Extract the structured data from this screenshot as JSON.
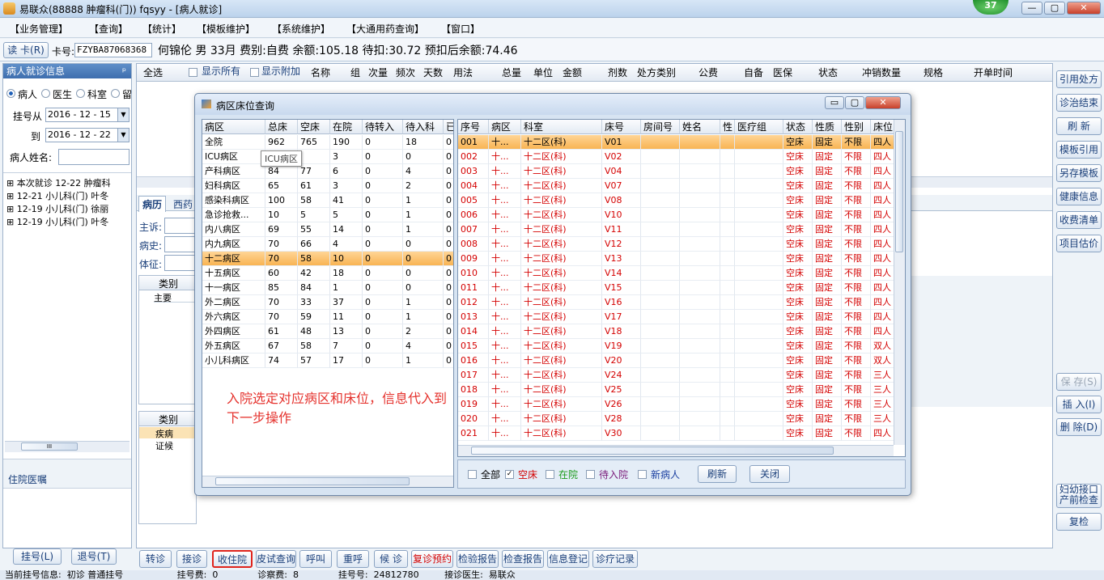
{
  "window": {
    "title": "易联众(88888 肿瘤科(门)) fqsyy - [病人就诊]",
    "badge": "37",
    "min": "—",
    "max": "▢",
    "close": "✕"
  },
  "menu": [
    "【业务管理】",
    "【查询】",
    "【统计】",
    "【模板维护】",
    "【系统维护】",
    "【大通用药查询】",
    "【窗口】"
  ],
  "patient": {
    "read_card": "读 卡(R)",
    "card_label": "卡号:",
    "card_no": "FZYBA87068368",
    "summary": "何锦伦 男 33月 费别:自费 余额:105.18 待扣:30.72 预扣后余额:74.46"
  },
  "left": {
    "header": "病人就诊信息",
    "pin": "ᵖ",
    "radios": [
      "病人",
      "医生",
      "科室",
      "留"
    ],
    "date_from_label": "挂号从",
    "date_from": "2016 - 12 - 15",
    "date_to_label": "到",
    "date_to": "2016 - 12 - 22",
    "name_label": "病人姓名:",
    "tree": [
      "本次就诊 12-22 肿瘤科",
      "12-21 小儿科(门) 叶冬",
      "12-19 小儿科(门) 徐丽",
      "12-19 小儿科(门) 叶冬"
    ],
    "scroll_thumb": "III",
    "advice_label": "住院医嘱",
    "btn_register": "挂号(L)",
    "btn_return": "退号(T)"
  },
  "center": {
    "columns": [
      "全选",
      "显示所有",
      "显示附加",
      "名称",
      "组",
      "次量",
      "频次",
      "天数",
      "用法",
      "总量",
      "单位",
      "金额",
      "剂数",
      "处方类别",
      "公费",
      "自备",
      "医保",
      "状态",
      "冲销数量",
      "规格",
      "开单时间"
    ],
    "tabs": [
      "病历",
      "西药"
    ],
    "fields": [
      "主诉:",
      "病史:",
      "体征:"
    ],
    "grid1": {
      "col": "类别",
      "row": "主要"
    },
    "grid2": {
      "col": "类别",
      "rows": [
        "疾病",
        "证候"
      ]
    }
  },
  "right_buttons": [
    "引用处方",
    "诊治结束",
    "刷 新",
    "模板引用",
    "另存模板",
    "健康信息",
    "收费清单",
    "项目估价"
  ],
  "right_buttons_lower": [
    "保 存(S)",
    "插 入(I)",
    "删 除(D)"
  ],
  "right_buttons_bottom": [
    "妇幼接口\n产前检查",
    "复检"
  ],
  "bottom_buttons": [
    "转诊",
    "接诊",
    "收住院",
    "皮试查询",
    "呼叫",
    "重呼",
    "候 诊",
    "复诊预约",
    "检验报告",
    "检查报告",
    "信息登记",
    "诊疗记录"
  ],
  "status_line": "当前挂号信息:  初诊 普通挂号                   挂号费:  0              诊察费:  8              挂号号:  24812780         接诊医生:  易联众",
  "dialog": {
    "title": "病区床位查询",
    "ward_columns": [
      "病区",
      "总床",
      "空床",
      "在院",
      "待转入",
      "待入科",
      "已"
    ],
    "wards": [
      [
        "全院",
        "962",
        "765",
        "190",
        "0",
        "18",
        "0"
      ],
      [
        "ICU病区",
        "",
        "",
        "3",
        "0",
        "0",
        "0"
      ],
      [
        "产科病区",
        "84",
        "77",
        "6",
        "0",
        "4",
        "0"
      ],
      [
        "妇科病区",
        "65",
        "61",
        "3",
        "0",
        "2",
        "0"
      ],
      [
        "感染科病区",
        "100",
        "58",
        "41",
        "0",
        "1",
        "0"
      ],
      [
        "急诊抢救...",
        "10",
        "5",
        "5",
        "0",
        "1",
        "0"
      ],
      [
        "内八病区",
        "69",
        "55",
        "14",
        "0",
        "1",
        "0"
      ],
      [
        "内九病区",
        "70",
        "66",
        "4",
        "0",
        "0",
        "0"
      ],
      [
        "十二病区",
        "70",
        "58",
        "10",
        "0",
        "0",
        "0"
      ],
      [
        "十五病区",
        "60",
        "42",
        "18",
        "0",
        "0",
        "0"
      ],
      [
        "十一病区",
        "85",
        "84",
        "1",
        "0",
        "0",
        "0"
      ],
      [
        "外二病区",
        "70",
        "33",
        "37",
        "0",
        "1",
        "0"
      ],
      [
        "外六病区",
        "70",
        "59",
        "11",
        "0",
        "1",
        "0"
      ],
      [
        "外四病区",
        "61",
        "48",
        "13",
        "0",
        "2",
        "0"
      ],
      [
        "外五病区",
        "67",
        "58",
        "7",
        "0",
        "4",
        "0"
      ],
      [
        "小儿科病区",
        "74",
        "57",
        "17",
        "0",
        "1",
        "0"
      ]
    ],
    "tooltip": "ICU病区",
    "note": "入院选定对应病区和床位，信息代入到下一步操作",
    "bed_columns": [
      "序号",
      "病区",
      "科室",
      "床号",
      "房间号",
      "姓名",
      "性",
      "医疗组",
      "状态",
      "性质",
      "性别",
      "床位"
    ],
    "beds": [
      [
        "001",
        "十...",
        "十二区(科)",
        "V01",
        "空床",
        "固定",
        "不限",
        "四人"
      ],
      [
        "002",
        "十...",
        "十二区(科)",
        "V02",
        "空床",
        "固定",
        "不限",
        "四人"
      ],
      [
        "003",
        "十...",
        "十二区(科)",
        "V04",
        "空床",
        "固定",
        "不限",
        "四人"
      ],
      [
        "004",
        "十...",
        "十二区(科)",
        "V07",
        "空床",
        "固定",
        "不限",
        "四人"
      ],
      [
        "005",
        "十...",
        "十二区(科)",
        "V08",
        "空床",
        "固定",
        "不限",
        "四人"
      ],
      [
        "006",
        "十...",
        "十二区(科)",
        "V10",
        "空床",
        "固定",
        "不限",
        "四人"
      ],
      [
        "007",
        "十...",
        "十二区(科)",
        "V11",
        "空床",
        "固定",
        "不限",
        "四人"
      ],
      [
        "008",
        "十...",
        "十二区(科)",
        "V12",
        "空床",
        "固定",
        "不限",
        "四人"
      ],
      [
        "009",
        "十...",
        "十二区(科)",
        "V13",
        "空床",
        "固定",
        "不限",
        "四人"
      ],
      [
        "010",
        "十...",
        "十二区(科)",
        "V14",
        "空床",
        "固定",
        "不限",
        "四人"
      ],
      [
        "011",
        "十...",
        "十二区(科)",
        "V15",
        "空床",
        "固定",
        "不限",
        "四人"
      ],
      [
        "012",
        "十...",
        "十二区(科)",
        "V16",
        "空床",
        "固定",
        "不限",
        "四人"
      ],
      [
        "013",
        "十...",
        "十二区(科)",
        "V17",
        "空床",
        "固定",
        "不限",
        "四人"
      ],
      [
        "014",
        "十...",
        "十二区(科)",
        "V18",
        "空床",
        "固定",
        "不限",
        "四人"
      ],
      [
        "015",
        "十...",
        "十二区(科)",
        "V19",
        "空床",
        "固定",
        "不限",
        "双人"
      ],
      [
        "016",
        "十...",
        "十二区(科)",
        "V20",
        "空床",
        "固定",
        "不限",
        "双人"
      ],
      [
        "017",
        "十...",
        "十二区(科)",
        "V24",
        "空床",
        "固定",
        "不限",
        "三人"
      ],
      [
        "018",
        "十...",
        "十二区(科)",
        "V25",
        "空床",
        "固定",
        "不限",
        "三人"
      ],
      [
        "019",
        "十...",
        "十二区(科)",
        "V26",
        "空床",
        "固定",
        "不限",
        "三人"
      ],
      [
        "020",
        "十...",
        "十二区(科)",
        "V28",
        "空床",
        "固定",
        "不限",
        "三人"
      ],
      [
        "021",
        "十...",
        "十二区(科)",
        "V30",
        "空床",
        "固定",
        "不限",
        "四人"
      ]
    ],
    "filters": [
      {
        "label": "全部",
        "checked": false,
        "color": "#000000"
      },
      {
        "label": "空床",
        "checked": true,
        "color": "#d40000"
      },
      {
        "label": "在院",
        "checked": false,
        "color": "#1a9a1a"
      },
      {
        "label": "待入院",
        "checked": false,
        "color": "#7a1a7a"
      },
      {
        "label": "新病人",
        "checked": false,
        "color": "#1a3fa0"
      }
    ],
    "btn_refresh": "刷新",
    "btn_close": "关闭"
  }
}
